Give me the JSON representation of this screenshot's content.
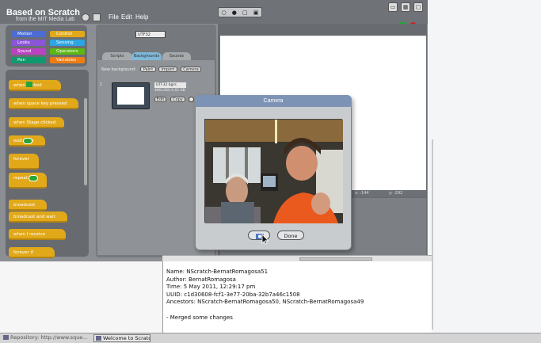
{
  "app": {
    "logo_line1": "Based on Scratch",
    "logo_line2": "from the MIT Media Lab",
    "menus": [
      "File",
      "Edit",
      "Help"
    ]
  },
  "categories": [
    {
      "label": "Motion",
      "color": "#4a6cd4"
    },
    {
      "label": "Control",
      "color": "#e1a91a"
    },
    {
      "label": "Looks",
      "color": "#8a55d7"
    },
    {
      "label": "Sensing",
      "color": "#2ca5e2"
    },
    {
      "label": "Sound",
      "color": "#bb42c3"
    },
    {
      "label": "Operators",
      "color": "#5cb712"
    },
    {
      "label": "Pen",
      "color": "#0e9a6c"
    },
    {
      "label": "Variables",
      "color": "#ee7d16"
    }
  ],
  "palette_blocks": [
    "when clicked",
    "when space key pressed",
    "when Stage clicked",
    "wait secs",
    "forever",
    "repeat",
    "broadcast",
    "broadcast and wait",
    "when I receive",
    "forever if"
  ],
  "sprite": {
    "name": "UTF32"
  },
  "tabs": [
    "Scripts",
    "Backgrounds",
    "Sounds"
  ],
  "backgrounds": {
    "new_label": "New background:",
    "paint": "Paint",
    "import": "Import",
    "camera": "Camera",
    "item_number": "1",
    "item_name": "UTF32 bgrs",
    "item_size": "480x360 0.01 KB",
    "edit": "Edit",
    "copy": "Copy"
  },
  "stage": {
    "x_readout": "x: -144",
    "y_readout": "y: -292"
  },
  "dialog": {
    "title": "Camera",
    "done": "Done"
  },
  "commit": {
    "lines": [
      "Name: NScratch-BernatRomagosa51",
      "Author: BernatRomagosa",
      "Time: 5 May 2011, 12:29:17 pm",
      "UUID: c1d30608-fcf1-3e77-20ba-32b7a46c1508",
      "Ancestors: NScratch-BernatRomagosa50, NScratch-BernatRomagosa49",
      "",
      "- Merged some changes"
    ]
  },
  "taskbar": {
    "item1": "Repository: http://www.sque...",
    "item2": "Welcome to Scratch"
  },
  "colors": {
    "flag": "#27a53c",
    "stop": "#d11e1e",
    "control": "#e1a91a"
  }
}
